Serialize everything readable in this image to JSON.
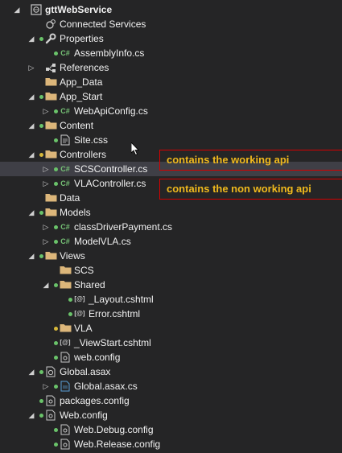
{
  "tree": [
    {
      "label": "gttWebService",
      "level": 0,
      "arrow": "expanded",
      "dot": null,
      "icon": "project-icon",
      "bold": true
    },
    {
      "label": "Connected Services",
      "level": 1,
      "arrow": null,
      "dot": null,
      "icon": "connected-services-icon"
    },
    {
      "label": "Properties",
      "level": 1,
      "arrow": "expanded",
      "dot": "green",
      "icon": "wrench-icon"
    },
    {
      "label": "AssemblyInfo.cs",
      "level": 2,
      "arrow": null,
      "dot": "green",
      "icon": "csharp-file-icon"
    },
    {
      "label": "References",
      "level": 1,
      "arrow": "collapsed",
      "dot": null,
      "icon": "references-icon"
    },
    {
      "label": "App_Data",
      "level": 1,
      "arrow": null,
      "dot": null,
      "icon": "folder-icon"
    },
    {
      "label": "App_Start",
      "level": 1,
      "arrow": "expanded",
      "dot": "green",
      "icon": "folder-icon"
    },
    {
      "label": "WebApiConfig.cs",
      "level": 2,
      "arrow": "collapsed",
      "dot": "green",
      "icon": "csharp-file-icon"
    },
    {
      "label": "Content",
      "level": 1,
      "arrow": "expanded",
      "dot": "green",
      "icon": "folder-icon"
    },
    {
      "label": "Site.css",
      "level": 2,
      "arrow": null,
      "dot": "green",
      "icon": "css-file-icon"
    },
    {
      "label": "Controllers",
      "level": 1,
      "arrow": "expanded",
      "dot": "yellow",
      "icon": "folder-icon"
    },
    {
      "label": "SCSController.cs",
      "level": 2,
      "arrow": "collapsed",
      "dot": "green",
      "icon": "csharp-file-icon",
      "selected": true
    },
    {
      "label": "VLAController.cs",
      "level": 2,
      "arrow": "collapsed",
      "dot": "green",
      "icon": "csharp-file-icon"
    },
    {
      "label": "Data",
      "level": 1,
      "arrow": null,
      "dot": null,
      "icon": "folder-icon"
    },
    {
      "label": "Models",
      "level": 1,
      "arrow": "expanded",
      "dot": "green",
      "icon": "folder-icon"
    },
    {
      "label": "classDriverPayment.cs",
      "level": 2,
      "arrow": "collapsed",
      "dot": "green",
      "icon": "csharp-file-icon"
    },
    {
      "label": "ModelVLA.cs",
      "level": 2,
      "arrow": "collapsed",
      "dot": "green",
      "icon": "csharp-file-icon"
    },
    {
      "label": "Views",
      "level": 1,
      "arrow": "expanded",
      "dot": "green",
      "icon": "folder-icon"
    },
    {
      "label": "SCS",
      "level": 2,
      "arrow": null,
      "dot": null,
      "icon": "folder-icon"
    },
    {
      "label": "Shared",
      "level": 2,
      "arrow": "expanded",
      "dot": "green",
      "icon": "folder-icon"
    },
    {
      "label": "_Layout.cshtml",
      "level": 3,
      "arrow": null,
      "dot": "green",
      "icon": "cshtml-file-icon"
    },
    {
      "label": "Error.cshtml",
      "level": 3,
      "arrow": null,
      "dot": "green",
      "icon": "cshtml-file-icon"
    },
    {
      "label": "VLA",
      "level": 2,
      "arrow": null,
      "dot": "yellow",
      "icon": "folder-icon"
    },
    {
      "label": "_ViewStart.cshtml",
      "level": 2,
      "arrow": null,
      "dot": "green",
      "icon": "cshtml-file-icon"
    },
    {
      "label": "web.config",
      "level": 2,
      "arrow": null,
      "dot": "green",
      "icon": "config-file-icon"
    },
    {
      "label": "Global.asax",
      "level": 1,
      "arrow": "expanded",
      "dot": "green",
      "icon": "asax-file-icon"
    },
    {
      "label": "Global.asax.cs",
      "level": 2,
      "arrow": "collapsed",
      "dot": "green",
      "icon": "csharp-config-file-icon"
    },
    {
      "label": "packages.config",
      "level": 1,
      "arrow": null,
      "dot": "green",
      "icon": "config-file-icon"
    },
    {
      "label": "Web.config",
      "level": 1,
      "arrow": "expanded",
      "dot": "green",
      "icon": "config-file-icon"
    },
    {
      "label": "Web.Debug.config",
      "level": 2,
      "arrow": null,
      "dot": "green",
      "icon": "config-file-icon"
    },
    {
      "label": "Web.Release.config",
      "level": 2,
      "arrow": null,
      "dot": "green",
      "icon": "config-file-icon"
    }
  ],
  "annotations": {
    "working": "contains the working api",
    "non_working": "contains the non working api"
  },
  "colors": {
    "background": "#252526",
    "selected_row": "#3f3f46",
    "annotation_text": "#f0b91d",
    "annotation_border": "#d40000",
    "folder": "#dcb67a",
    "git_green": "#6ac36a",
    "git_yellow": "#d7b83a"
  }
}
